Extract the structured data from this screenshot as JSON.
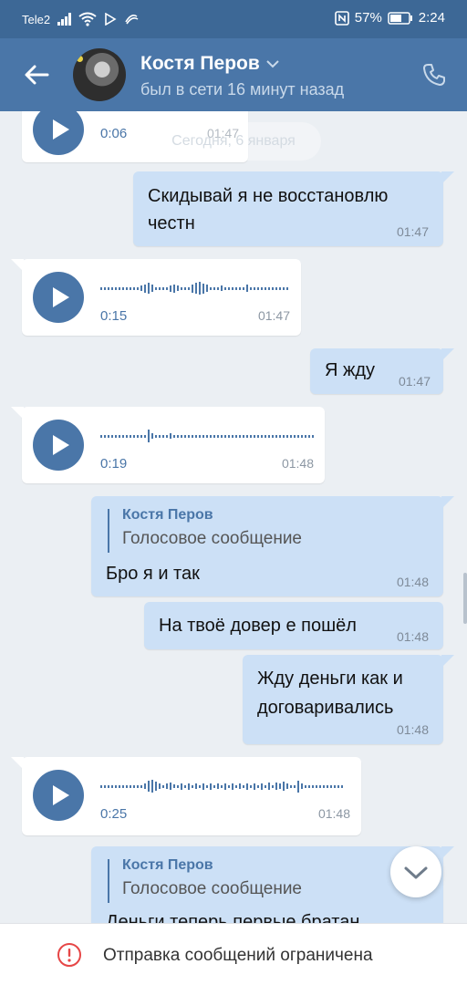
{
  "status_bar": {
    "carrier": "Tele2",
    "battery": "57%",
    "time": "2:24",
    "icons": [
      "signal-icon",
      "wifi-icon",
      "nfc-icon",
      "battery-icon"
    ]
  },
  "header": {
    "name": "Костя Перов",
    "status": "был в сети 16 минут назад",
    "icons": [
      "back-arrow-icon",
      "chevron-down-icon",
      "phone-icon"
    ]
  },
  "chat": {
    "date_divider": "Сегодня, 6 января",
    "messages": [
      {
        "type": "voice",
        "direction": "in",
        "duration": "0:06",
        "time": "01:47"
      },
      {
        "type": "text",
        "direction": "out",
        "lines": [
          "Скидывай я не восстановлю",
          "честн"
        ],
        "time": "01:47"
      },
      {
        "type": "voice",
        "direction": "in",
        "duration": "0:15",
        "time": "01:47"
      },
      {
        "type": "text",
        "direction": "out",
        "lines": [
          "Я жду"
        ],
        "time": "01:47"
      },
      {
        "type": "voice",
        "direction": "in",
        "duration": "0:19",
        "time": "01:48"
      },
      {
        "type": "reply",
        "direction": "out",
        "reply_author": "Костя Перов",
        "reply_preview": "Голосовое сообщение",
        "text": "Бро я и так",
        "time": "01:48"
      },
      {
        "type": "text",
        "direction": "out",
        "lines": [
          "На твоё довер е пошёл"
        ],
        "time": "01:48"
      },
      {
        "type": "text",
        "direction": "out",
        "lines": [
          "Жду деньги как и",
          "договаривались"
        ],
        "time": "01:48"
      },
      {
        "type": "voice",
        "direction": "in",
        "duration": "0:25",
        "time": "01:48"
      },
      {
        "type": "reply",
        "direction": "out",
        "reply_author": "Костя Перов",
        "reply_preview": "Голосовое сообщение",
        "text": "Деньги теперь первые братан",
        "time": ""
      }
    ]
  },
  "bottom_bar": {
    "text": "Отправка сообщений ограничена",
    "icon": "warning-circle-icon"
  },
  "colors": {
    "header": "#4a76a8",
    "status_bar": "#3d6896",
    "outgoing_bubble": "#cce0f6",
    "incoming_bubble": "#ffffff",
    "background": "#ebeff3",
    "warning": "#e64646"
  }
}
